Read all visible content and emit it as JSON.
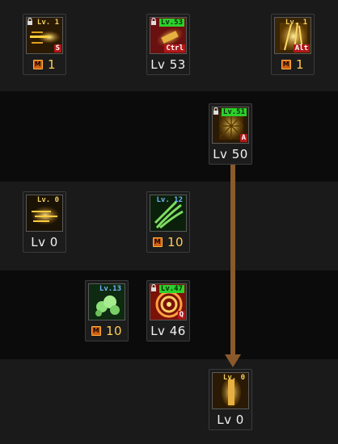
{
  "skills": [
    {
      "id": "s1",
      "lv_tag": "Lv. 1",
      "lv_style": "gold",
      "locked": true,
      "hotkey": "S",
      "bottom_type": "m",
      "bottom_value": "1",
      "art": "gold-projectile"
    },
    {
      "id": "s2",
      "lv_tag": "Lv.53",
      "lv_style": "green",
      "locked": true,
      "hotkey": "Ctrl",
      "bottom_type": "lv",
      "bottom_value": "Lv 53",
      "art": "red-gold-rush"
    },
    {
      "id": "s3",
      "lv_tag": "Lv. 1",
      "lv_style": "gold",
      "locked": false,
      "hotkey": "Alt",
      "bottom_type": "m",
      "bottom_value": "1",
      "art": "gold-burst"
    },
    {
      "id": "s4",
      "lv_tag": "Lv.51",
      "lv_style": "green",
      "locked": true,
      "hotkey": "A",
      "bottom_type": "lv",
      "bottom_value": "Lv 50",
      "art": "gold-web"
    },
    {
      "id": "s5",
      "lv_tag": "Lv. 0",
      "lv_style": "gold",
      "locked": false,
      "hotkey": "",
      "bottom_type": "lv",
      "bottom_value": "Lv 0",
      "art": "gold-swirl"
    },
    {
      "id": "s6",
      "lv_tag": "Lv. 12",
      "lv_style": "blue",
      "locked": false,
      "hotkey": "",
      "bottom_type": "m",
      "bottom_value": "10",
      "art": "green-claw"
    },
    {
      "id": "s7",
      "lv_tag": "Lv.13",
      "lv_style": "blue",
      "locked": false,
      "hotkey": "",
      "bottom_type": "m",
      "bottom_value": "10",
      "art": "green-cloud"
    },
    {
      "id": "s8",
      "lv_tag": "Lv.47",
      "lv_style": "green",
      "locked": true,
      "hotkey": "Q",
      "bottom_type": "lv",
      "bottom_value": "Lv 46",
      "art": "orange-spiral"
    },
    {
      "id": "s9",
      "lv_tag": "Lv. 0",
      "lv_style": "gold",
      "locked": false,
      "hotkey": "",
      "bottom_type": "lv",
      "bottom_value": "Lv 0",
      "art": "gold-pillar"
    }
  ],
  "m_badge": "M",
  "colors": {
    "band_light": "#1a1a1a",
    "band_dark": "#0b0b0b",
    "arrow": "#8a5a2b"
  }
}
